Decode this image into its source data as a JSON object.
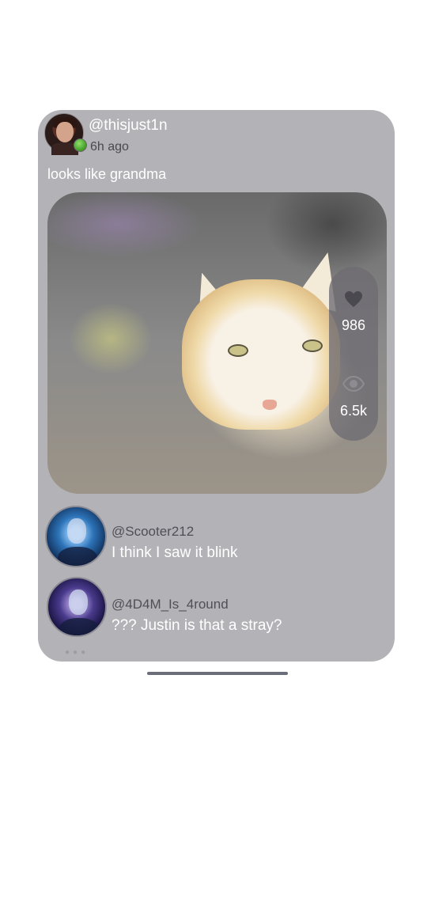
{
  "post": {
    "author": "@thisjust1n",
    "time": "6h ago",
    "caption": "looks like grandma",
    "stats": {
      "likes": "986",
      "views": "6.5k"
    }
  },
  "comments": [
    {
      "user": "@Scooter212",
      "text": "I think I saw it blink"
    },
    {
      "user": "@4D4M_Is_4round",
      "text": "??? Justin is that a stray?"
    }
  ],
  "colors": {
    "card": "#b3b2b7",
    "online": "#4caf2a",
    "home_indicator": "#6a6e79"
  },
  "icons": [
    "heart-icon",
    "eye-icon"
  ]
}
